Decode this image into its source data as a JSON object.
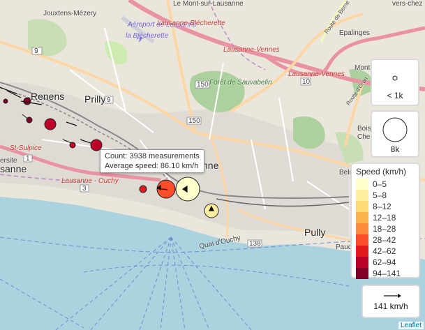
{
  "places": {
    "jouxtens": "Jouxtens-Mézery",
    "mont": "Le Mont-sur-Lausanne",
    "versches": "vers-chez",
    "aeroport1": "Aéroport de Lausanne",
    "aeroport2": "la Blécherette",
    "blecherette": "Lausanne-Blécherette",
    "vennes1": "Lausanne-Vennes",
    "vennes2": "Lausanne-Vennes",
    "epalinges": "Epalinges",
    "montblesson": "Montblesson",
    "renens": "Renens",
    "prilly": "Prilly",
    "foret": "Forêt de Sauvabelin",
    "stsulpice": "St-Sulpice",
    "ersite": "ersite",
    "sanne": "sanne",
    "lausanne_center": "nne",
    "ouchy": "Lausanne - Ouchy",
    "pully": "Pully",
    "paud": "Paud",
    "bois": "Bois",
    "chem": "Chem",
    "quai": "Quai d'Ouchy",
    "route_berne": "Route de Berne",
    "route_oron": "Route d'Oron",
    "belm": "Belm"
  },
  "road_numbers": [
    "9",
    "150",
    "150",
    "10",
    "9",
    "3",
    "138",
    "1"
  ],
  "tooltip": {
    "count": "Count: 3938 measurements",
    "avg": "Average speed: 86.10 km/h"
  },
  "size_legend": {
    "small_label": "< 1k",
    "large_label": "8k"
  },
  "speed_legend": {
    "title": "Speed (km/h)",
    "items": [
      {
        "label": "0–5",
        "color": "#ffffcc"
      },
      {
        "label": "5–8",
        "color": "#ffeda0"
      },
      {
        "label": "8–12",
        "color": "#fed976"
      },
      {
        "label": "12–18",
        "color": "#feb24c"
      },
      {
        "label": "18–28",
        "color": "#fd8d3c"
      },
      {
        "label": "28–42",
        "color": "#fc4e2a"
      },
      {
        "label": "42–62",
        "color": "#e31a1c"
      },
      {
        "label": "62–94",
        "color": "#bd0026"
      },
      {
        "label": "94–141",
        "color": "#800026"
      }
    ]
  },
  "speed_arrow_label": "141 km/h",
  "attribution": "Leaflet"
}
